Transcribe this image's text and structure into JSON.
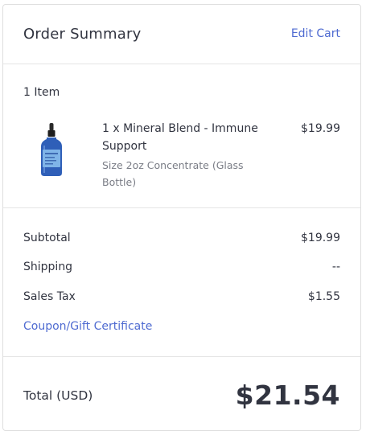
{
  "header": {
    "title": "Order Summary",
    "edit_cart_label": "Edit Cart"
  },
  "items": {
    "count_label": "1 Item",
    "list": [
      {
        "name": "1 x Mineral Blend - Immune Support",
        "option": "Size 2oz Concentrate (Glass Bottle)",
        "price": "$19.99",
        "image_icon": "product-bottle-image"
      }
    ]
  },
  "totals": {
    "subtotal_label": "Subtotal",
    "subtotal_value": "$19.99",
    "shipping_label": "Shipping",
    "shipping_value": "--",
    "tax_label": "Sales Tax",
    "tax_value": "$1.55",
    "coupon_label": "Coupon/Gift Certificate"
  },
  "grand_total": {
    "label": "Total (USD)",
    "value": "$21.54"
  },
  "colors": {
    "link": "#4f6bd1",
    "text": "#313440",
    "muted": "#7a7d86"
  }
}
